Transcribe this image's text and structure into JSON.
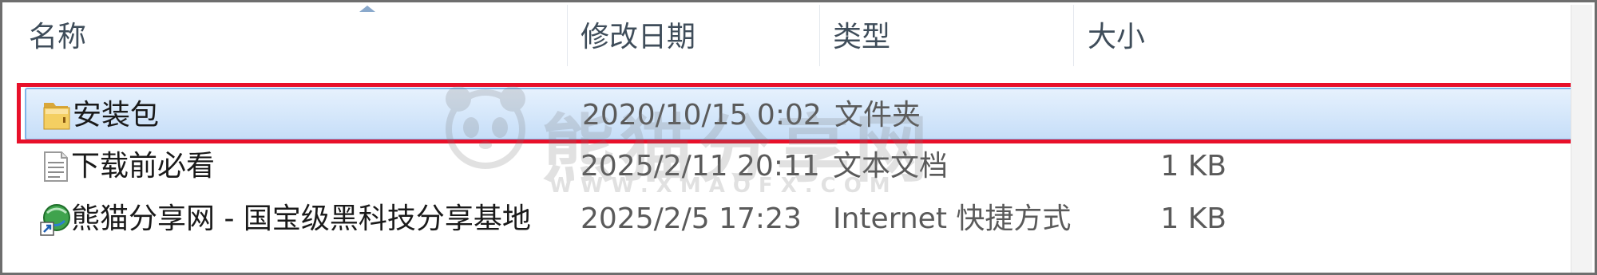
{
  "columns": {
    "name": "名称",
    "modified": "修改日期",
    "type": "类型",
    "size": "大小"
  },
  "files": [
    {
      "name": "安装包",
      "modified": "2020/10/15 0:02",
      "type": "文件夹",
      "size": "",
      "icon": "folder-icon",
      "selected": true
    },
    {
      "name": "下载前必看",
      "modified": "2025/2/11 20:11",
      "type": "文本文档",
      "size": "1 KB",
      "icon": "text-document-icon",
      "selected": false
    },
    {
      "name": "熊猫分享网 - 国宝级黑科技分享基地",
      "modified": "2025/2/5 17:23",
      "type": "Internet 快捷方式",
      "size": "1 KB",
      "icon": "internet-shortcut-icon",
      "selected": false
    }
  ],
  "watermark": {
    "title": "熊猫分享网",
    "url": "WWW.XMAOFX.COM"
  },
  "colors": {
    "selection_bg_top": "#e6f1fd",
    "selection_bg_bottom": "#c6def8",
    "selection_border": "#7eb4ea",
    "highlight_box": "#e8102a",
    "header_text": "#3f4d5a"
  }
}
